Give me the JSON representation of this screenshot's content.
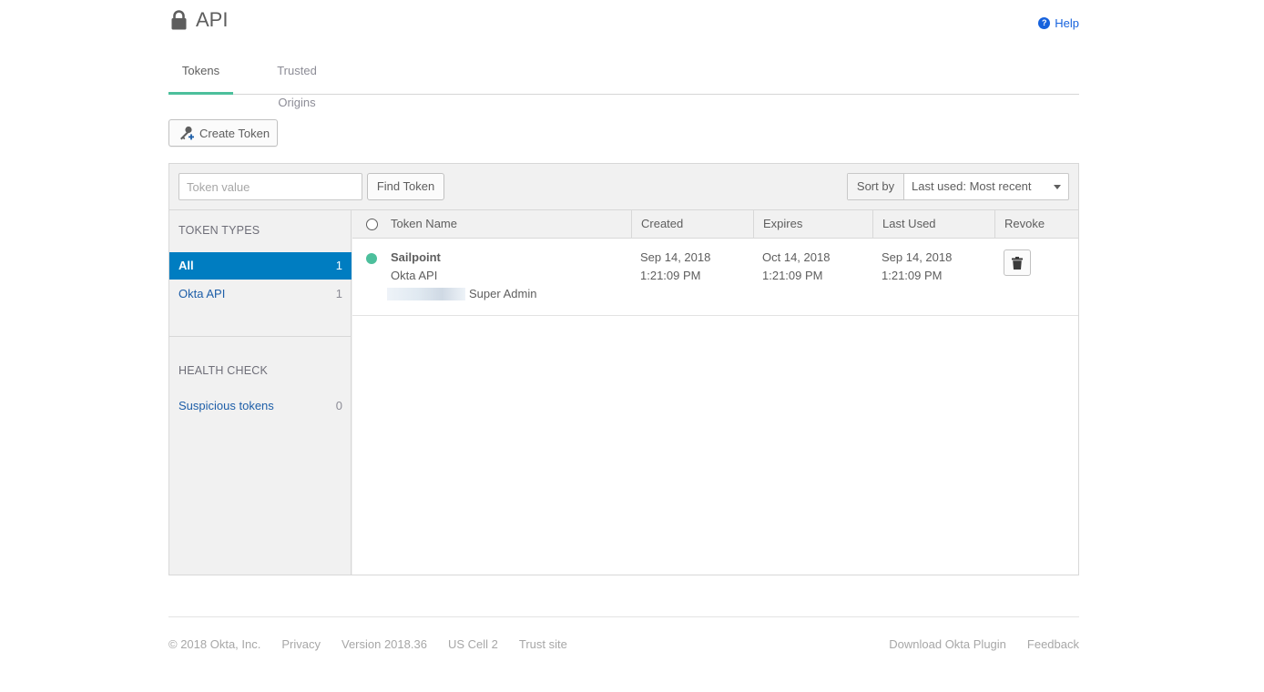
{
  "header": {
    "title": "API",
    "help_label": "Help",
    "help_icon_glyph": "?"
  },
  "tabs": [
    {
      "label": "Tokens",
      "active": true
    },
    {
      "label": "Trusted Origins",
      "active": false
    }
  ],
  "actions": {
    "create_token_label": "Create Token"
  },
  "toolbar": {
    "search_placeholder": "Token value",
    "search_value": "",
    "find_label": "Find Token",
    "sort_label": "Sort by",
    "sort_value": "Last used: Most recent"
  },
  "sidebar": {
    "token_types_heading": "TOKEN TYPES",
    "token_types": [
      {
        "label": "All",
        "count": "1",
        "selected": true
      },
      {
        "label": "Okta API",
        "count": "1",
        "selected": false
      }
    ],
    "health_heading": "HEALTH CHECK",
    "health_items": [
      {
        "label": "Suspicious tokens",
        "count": "0"
      }
    ]
  },
  "table": {
    "columns": {
      "name": "Token Name",
      "created": "Created",
      "expires": "Expires",
      "last_used": "Last Used",
      "revoke": "Revoke"
    },
    "rows": [
      {
        "status_color": "#4cbf9c",
        "name": "Sailpoint",
        "type": "Okta API",
        "owner_role": "Super Admin",
        "created_date": "Sep 14, 2018",
        "created_time": "1:21:09 PM",
        "expires_date": "Oct 14, 2018",
        "expires_time": "1:21:09 PM",
        "last_used_date": "Sep 14, 2018",
        "last_used_time": "1:21:09 PM"
      }
    ]
  },
  "footer": {
    "copyright": "© 2018 Okta, Inc.",
    "privacy": "Privacy",
    "version": "Version 2018.36",
    "cell": "US Cell 2",
    "trust": "Trust site",
    "download_plugin": "Download Okta Plugin",
    "feedback": "Feedback"
  },
  "colors": {
    "accent_tab": "#4cbf9c",
    "selected_blue": "#007dc1",
    "link_blue": "#1d5ea8",
    "help_blue": "#1662dd"
  }
}
